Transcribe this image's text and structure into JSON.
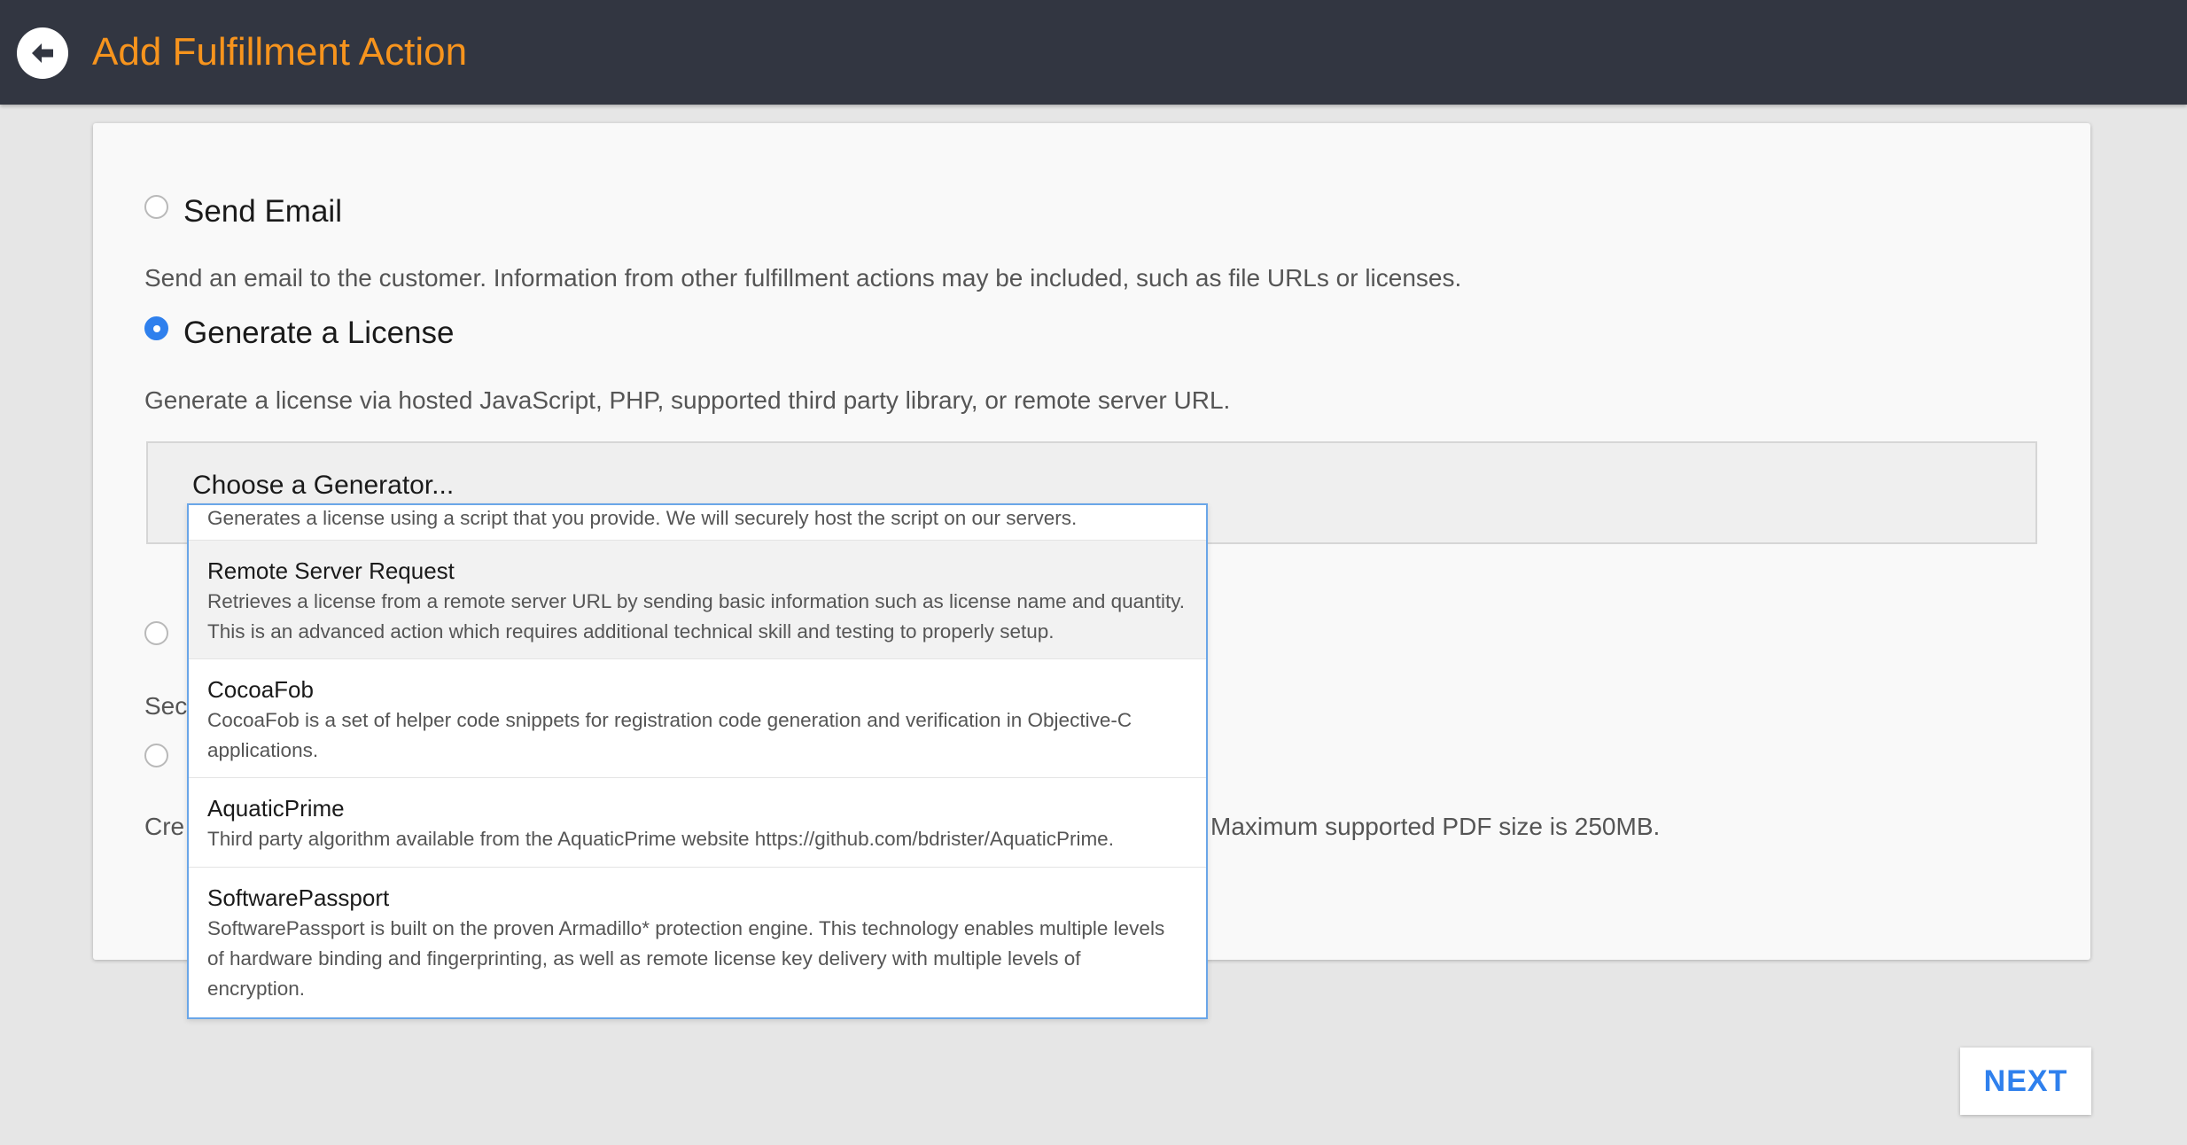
{
  "header": {
    "title": "Add Fulfillment Action",
    "back_icon": "arrow-left-icon"
  },
  "options": [
    {
      "title": "Send Email",
      "description": "Send an email to the customer. Information from other fulfillment actions may be included, such as file URLs or licenses.",
      "checked": false
    },
    {
      "title": "Generate a License",
      "description": "Generate a license via hosted JavaScript, PHP, supported third party library, or remote server URL.",
      "checked": true
    },
    {
      "title": "",
      "description_partial": "Sec",
      "checked": false
    },
    {
      "title": "",
      "description_partial": "Cre",
      "description_tail": "Maximum supported PDF size is 250MB.",
      "checked": false
    }
  ],
  "generator": {
    "label": "Choose a Generator...",
    "items": [
      {
        "name": "",
        "description": "Generates a license using a script that you provide. We will securely host the script on our servers."
      },
      {
        "name": "Remote Server Request",
        "description_lines": [
          "Retrieves a license from a remote server URL by sending basic information such as license name and quantity.",
          "This is an advanced action which requires additional technical skill and testing to properly setup."
        ]
      },
      {
        "name": "CocoaFob",
        "description_lines": [
          "CocoaFob is a set of helper code snippets for registration code generation and verification in Objective-C",
          "applications."
        ]
      },
      {
        "name": "AquaticPrime",
        "description_lines": [
          "Third party algorithm available from the AquaticPrime website https://github.com/bdrister/AquaticPrime."
        ]
      },
      {
        "name": "SoftwarePassport",
        "description_lines": [
          "SoftwarePassport is built on the proven Armadillo* protection engine. This technology enables multiple levels",
          "of hardware binding and fingerprinting, as well as remote license key delivery with multiple levels of",
          "encryption."
        ]
      }
    ]
  },
  "next_label": "NEXT",
  "colors": {
    "header_bg": "#323641",
    "title": "#f7941d",
    "accent": "#2f80ed",
    "page_bg": "#e6e6e6"
  }
}
